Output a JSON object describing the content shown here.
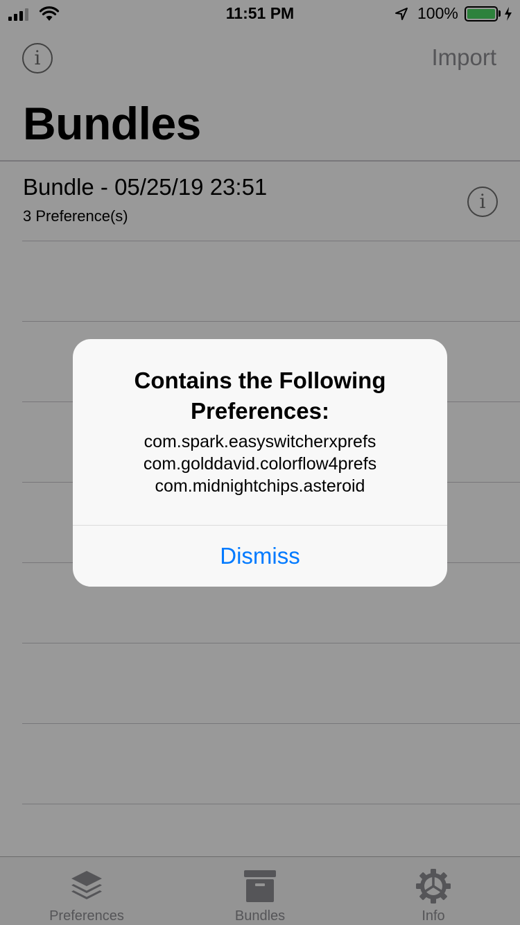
{
  "status_bar": {
    "time": "11:51 PM",
    "battery_percent": "100%",
    "battery_level": 1.0,
    "signal_bars_filled": 3,
    "signal_bars_total": 4,
    "icons": [
      "cellular-signal-icon",
      "wifi-icon",
      "location-arrow-icon",
      "battery-icon",
      "charging-bolt-icon"
    ]
  },
  "nav": {
    "left_icon": "info-icon",
    "right_button": "Import",
    "title": "Bundles"
  },
  "bundles": [
    {
      "name": "Bundle - 05/25/19 23:51",
      "subtitle": "3 Preference(s)",
      "accessory_icon": "info-icon"
    }
  ],
  "tab_bar": {
    "tabs": [
      {
        "label": "Preferences",
        "icon": "layers-stack-icon"
      },
      {
        "label": "Bundles",
        "icon": "archive-box-icon"
      },
      {
        "label": "Info",
        "icon": "gear-icon"
      }
    ]
  },
  "alert": {
    "title": "Contains the Following Preferences:",
    "message_lines": [
      "com.spark.easyswitcherxprefs",
      "com.golddavid.colorflow4prefs",
      "com.midnightchips.asteroid"
    ],
    "button": "Dismiss"
  },
  "colors": {
    "tint": "#007aff",
    "battery_green": "#4cd964",
    "inactive_gray": "#8e8e93",
    "separator": "#c8c7cc"
  }
}
